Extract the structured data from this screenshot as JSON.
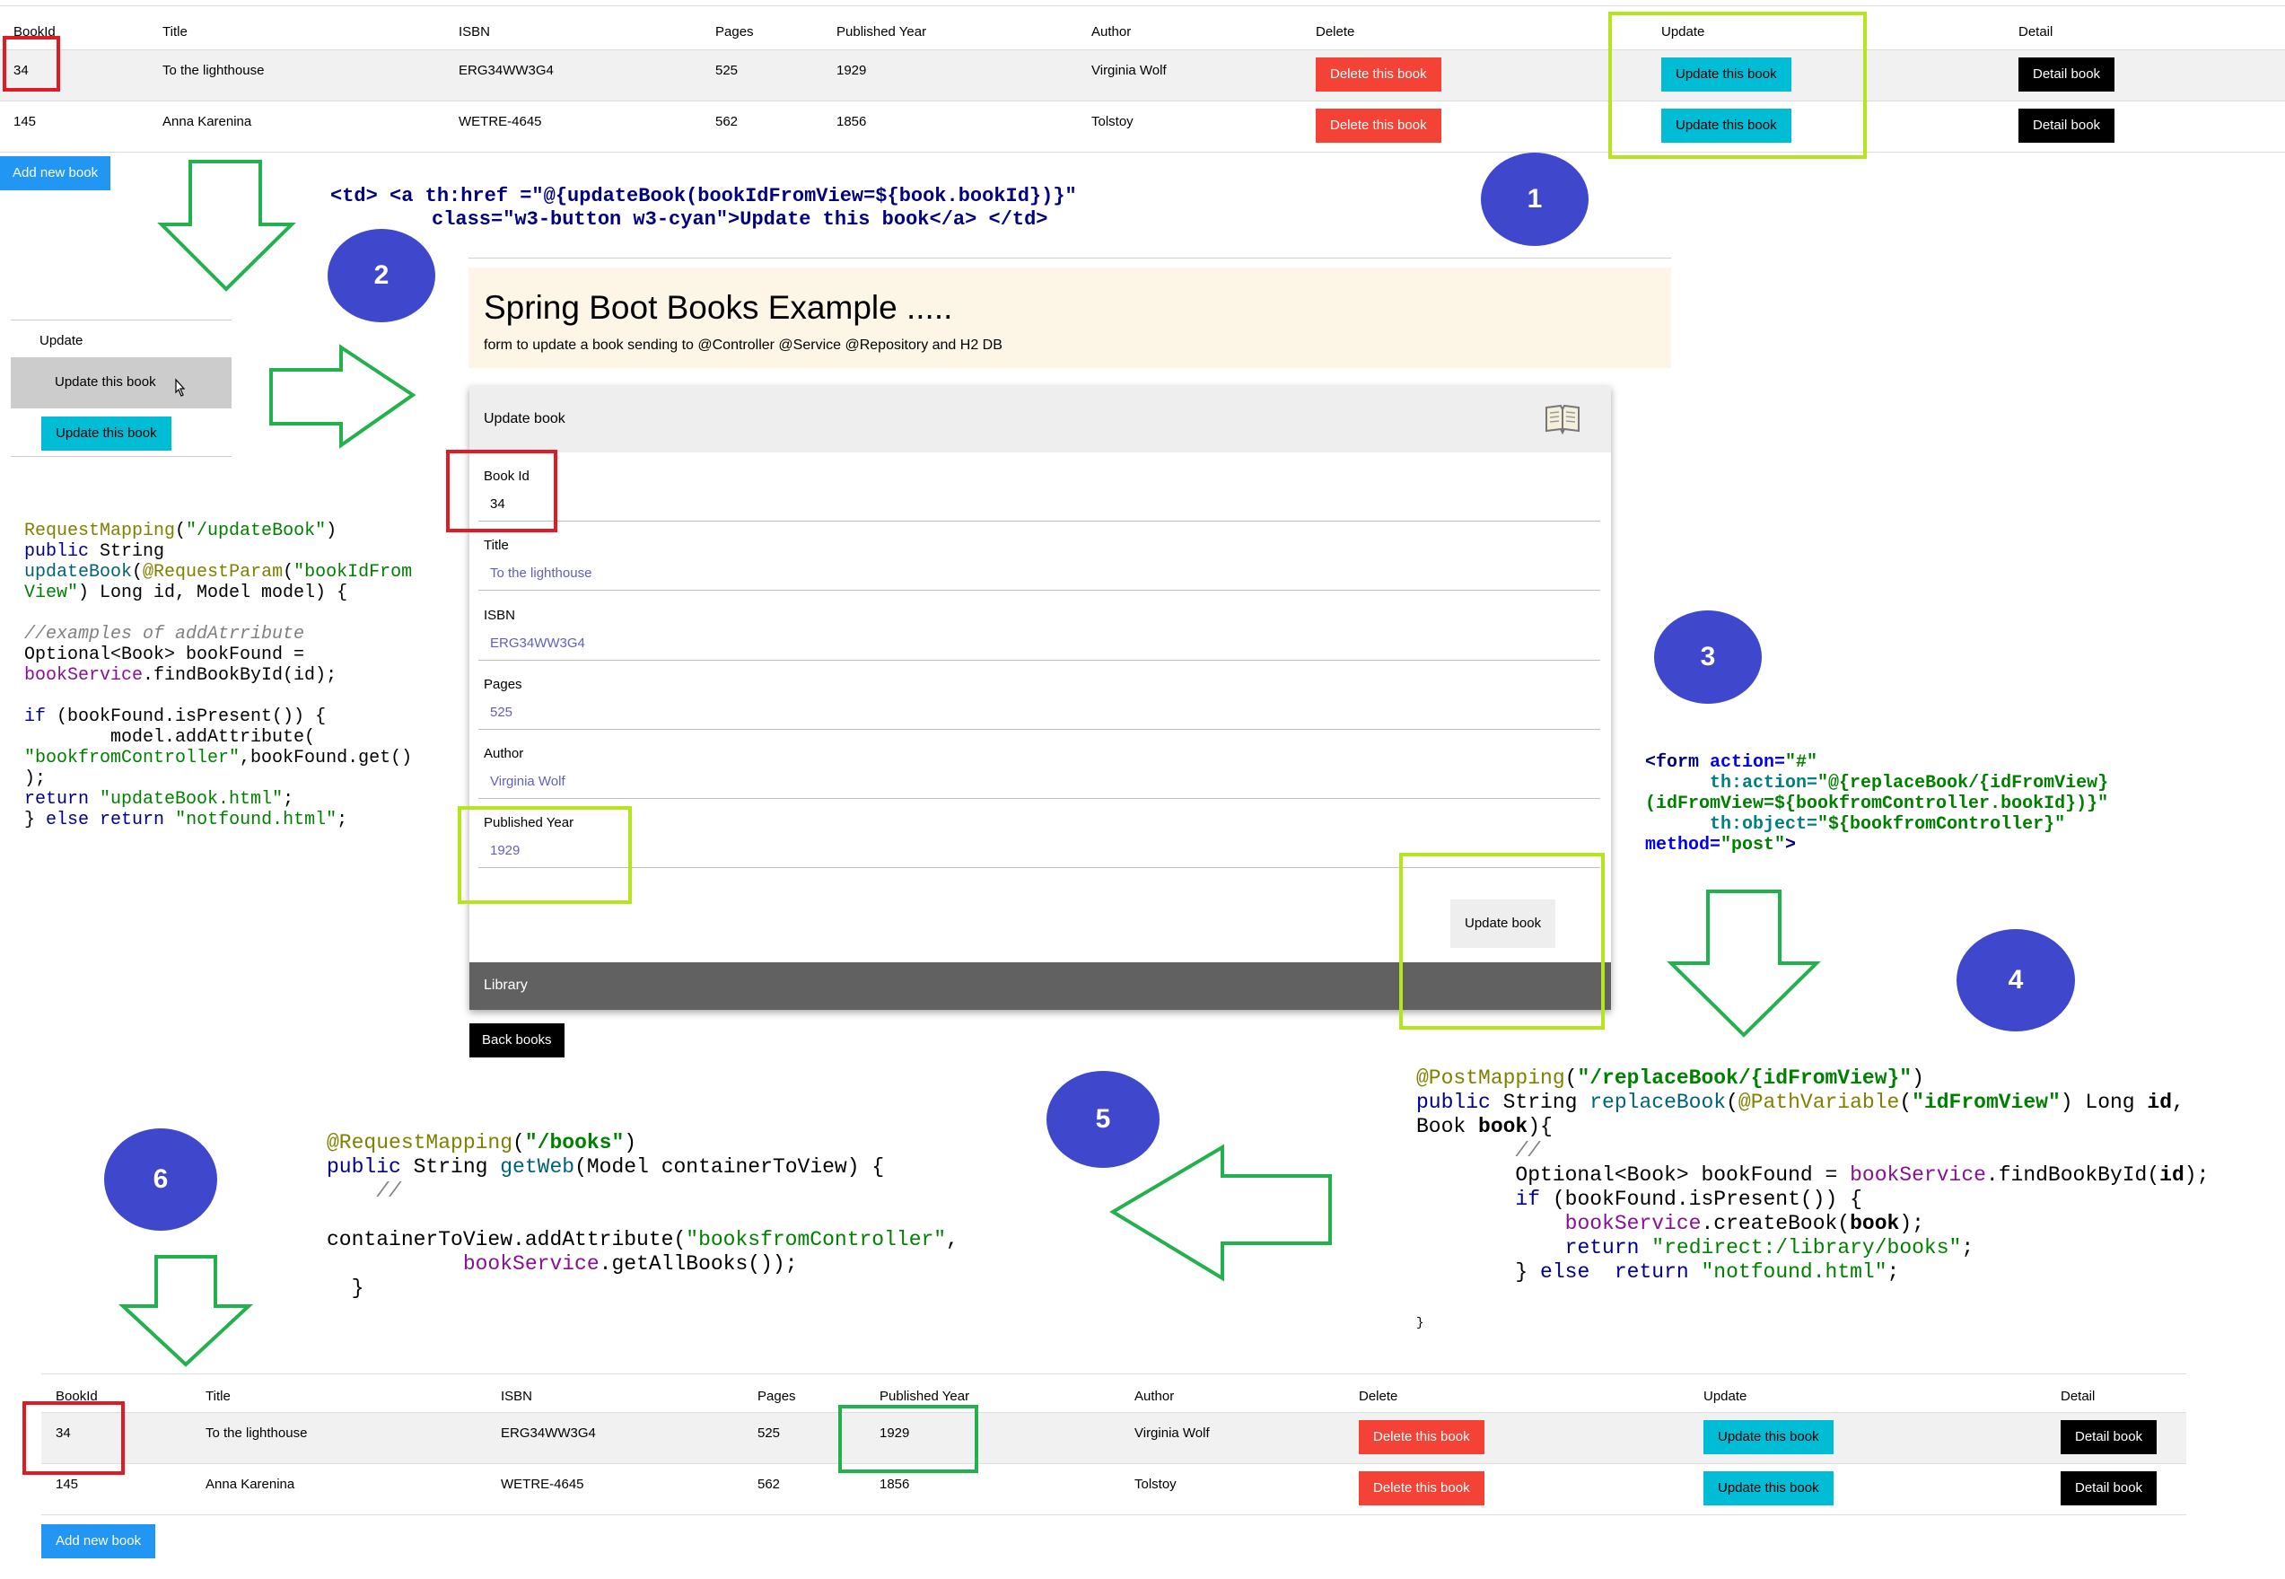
{
  "table_top": {
    "headers": [
      "BookId",
      "Title",
      "ISBN",
      "Pages",
      "Published Year",
      "Author",
      "Delete",
      "Update",
      "Detail"
    ],
    "rows": [
      {
        "id": "34",
        "title": "To the lighthouse",
        "isbn": "ERG34WW3G4",
        "pages": "525",
        "year": "1929",
        "author": "Virginia Wolf"
      },
      {
        "id": "145",
        "title": "Anna Karenina",
        "isbn": "WETRE-4645",
        "pages": "562",
        "year": "1856",
        "author": "Tolstoy"
      }
    ],
    "delete_label": "Delete this book",
    "update_label": "Update this book",
    "detail_label": "Detail book",
    "add_label": "Add new book"
  },
  "table_bottom": {
    "headers": [
      "BookId",
      "Title",
      "ISBN",
      "Pages",
      "Published Year",
      "Author",
      "Delete",
      "Update",
      "Detail"
    ],
    "rows": [
      {
        "id": "34",
        "title": "To the lighthouse",
        "isbn": "ERG34WW3G4",
        "pages": "525",
        "year": "1929",
        "author": "Virginia Wolf"
      },
      {
        "id": "145",
        "title": "Anna Karenina",
        "isbn": "WETRE-4645",
        "pages": "562",
        "year": "1856",
        "author": "Tolstoy"
      }
    ],
    "delete_label": "Delete this book",
    "update_label": "Update this book",
    "detail_label": "Detail book",
    "add_label": "Add new book"
  },
  "steps": [
    "1",
    "2",
    "3",
    "4",
    "5",
    "6"
  ],
  "hover_demo": {
    "header": "Update",
    "hover_button": "Update this book",
    "button": "Update this book"
  },
  "code_link": {
    "line1": "<td> <a th:href =\"@{updateBook(bookIdFromView=${book.bookId})}\"",
    "line2": "class=\"w3-button w3-cyan\">Update this book</a> </td>"
  },
  "form_page": {
    "title": "Spring Boot Books Example .....",
    "subtitle": "form to update a book sending to @Controller @Service @Repository and H2 DB",
    "card_title": "Update book",
    "fields": [
      {
        "label": "Book Id",
        "value": "34"
      },
      {
        "label": "Title",
        "value": "To the lighthouse"
      },
      {
        "label": "ISBN",
        "value": "ERG34WW3G4"
      },
      {
        "label": "Pages",
        "value": "525"
      },
      {
        "label": "Author",
        "value": "Virginia Wolf"
      },
      {
        "label": "Published Year",
        "value": "1929"
      }
    ],
    "submit_label": "Update book",
    "footer_label": "Library",
    "back_label": "Back books"
  }
}
